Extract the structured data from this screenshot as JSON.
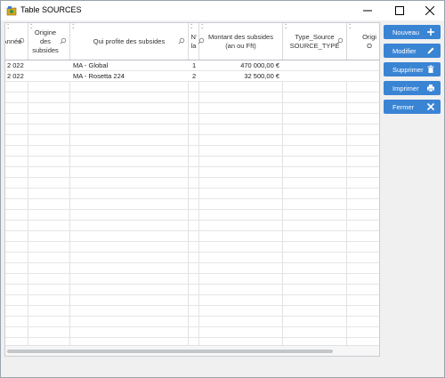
{
  "window": {
    "title": "Table SOURCES"
  },
  "grid": {
    "columns": [
      {
        "label": "Année",
        "has_search": true
      },
      {
        "label": "Origine des subsides",
        "has_search": true
      },
      {
        "label": "Qui profite des subsides",
        "has_search": true
      },
      {
        "label": "N° la",
        "has_search": true
      },
      {
        "label": "Montant des subsides (an ou Fft)",
        "has_search": true
      },
      {
        "label": "Type_Source SOURCE_TYPE",
        "has_search": true
      },
      {
        "label": "Origi O",
        "has_search": false
      }
    ],
    "rows": [
      {
        "annee": "2 022",
        "origine": "",
        "profite": "MA - Global",
        "num": "1",
        "montant": "470 000,00 €",
        "type": "",
        "orig": ""
      },
      {
        "annee": "2 022",
        "origine": "",
        "profite": "MA - Rosetta 224",
        "num": "2",
        "montant": "32 500,00 €",
        "type": "",
        "orig": ""
      }
    ]
  },
  "actions": {
    "new_label": "Nouveau",
    "modify_label": "Modifier",
    "delete_label": "Supprimer",
    "print_label": "Imprimer",
    "close_label": "Fermer"
  },
  "colors": {
    "accent": "#3a84d4"
  }
}
